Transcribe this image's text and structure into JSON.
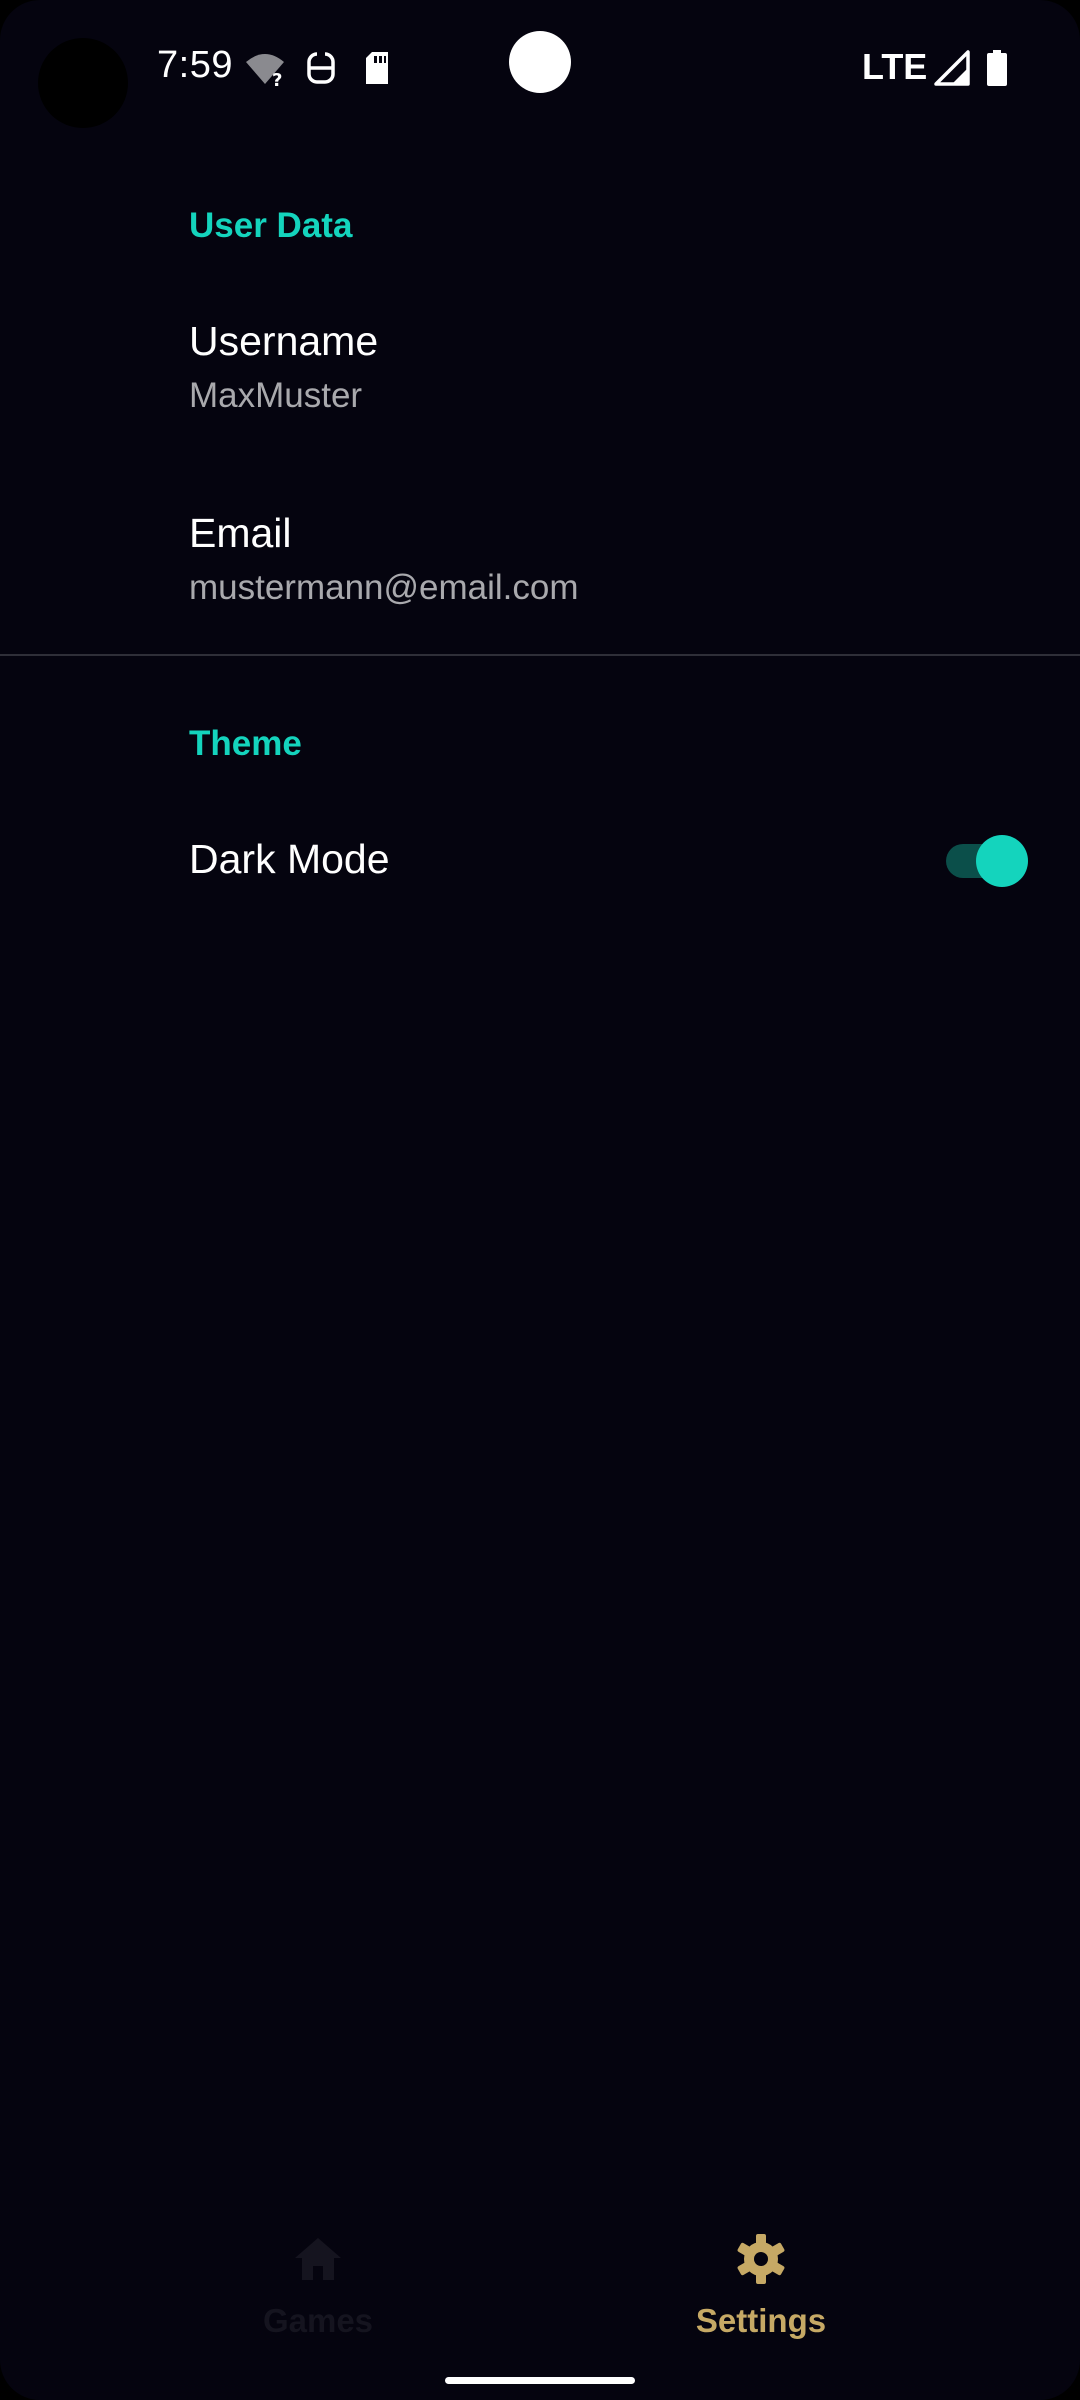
{
  "status_bar": {
    "time": "7:59",
    "network_label": "LTE",
    "icons": [
      "wifi-unknown-icon",
      "vpn-key-icon",
      "sd-card-icon",
      "cell-signal-icon",
      "battery-icon"
    ]
  },
  "sections": {
    "user_data": {
      "header": "User Data",
      "username": {
        "title": "Username",
        "value": "MaxMuster"
      },
      "email": {
        "title": "Email",
        "value": "mustermann@email.com"
      }
    },
    "theme": {
      "header": "Theme",
      "dark_mode": {
        "title": "Dark Mode",
        "enabled": true
      }
    }
  },
  "bottom_nav": {
    "items": [
      {
        "label": "Games",
        "icon": "home-icon",
        "selected": false
      },
      {
        "label": "Settings",
        "icon": "gear-icon",
        "selected": true
      }
    ]
  },
  "colors": {
    "background": "#05040f",
    "accent": "#14d4bd",
    "nav_selected": "#c6a965",
    "nav_unselected": "#15141f",
    "summary_text": "#a9a9ad"
  }
}
